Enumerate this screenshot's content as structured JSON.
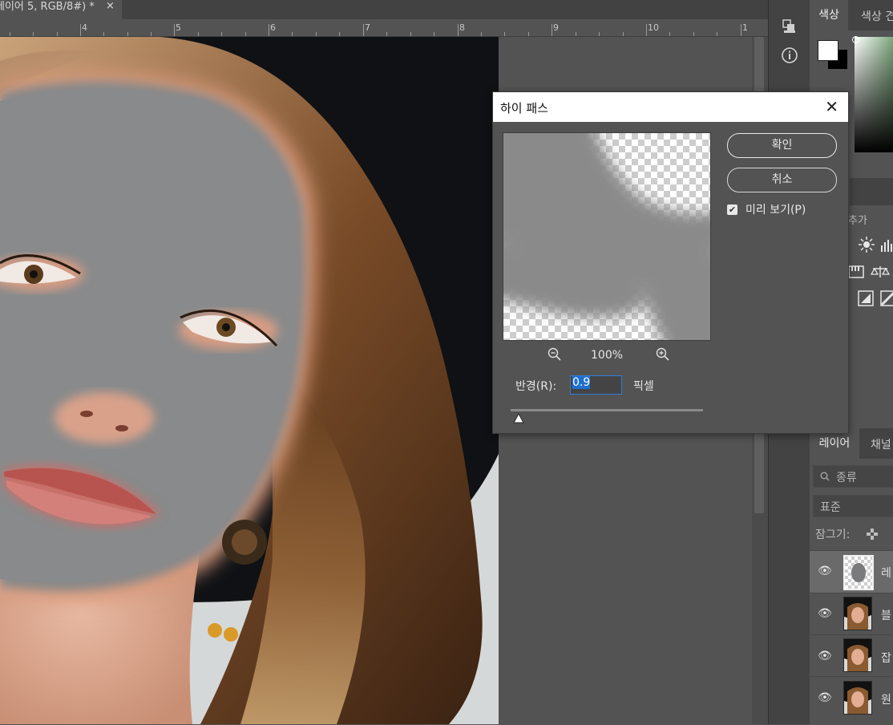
{
  "document": {
    "tab_title": "레이어 5, RGB/8#) *",
    "close_glyph": "×",
    "ruler_labels": [
      "4",
      "5",
      "6",
      "7",
      "8",
      "9",
      "10",
      "1"
    ]
  },
  "color_panel": {
    "tabs": [
      "색상",
      "색상 견"
    ]
  },
  "adjustments_panel": {
    "label": "추가"
  },
  "layers_panel": {
    "tabs": [
      "레이어",
      "채널"
    ],
    "kind_filter": "종류",
    "blend_mode": "표준",
    "lock_label": "잠그기:",
    "layers": [
      {
        "name": "레",
        "selected": true
      },
      {
        "name": "블",
        "selected": false
      },
      {
        "name": "잡",
        "selected": false
      },
      {
        "name": "원",
        "selected": false
      }
    ]
  },
  "dialog": {
    "title": "하이 패스",
    "close_glyph": "✕",
    "ok_label": "확인",
    "cancel_label": "취소",
    "preview_label": "미리 보기(P)",
    "preview_checked": true,
    "zoom_level": "100%",
    "radius_label": "반경(R):",
    "radius_value": "0.9",
    "radius_unit": "픽셀",
    "zoom_out_icon": "zoom-out-icon",
    "zoom_in_icon": "zoom-in-icon"
  }
}
